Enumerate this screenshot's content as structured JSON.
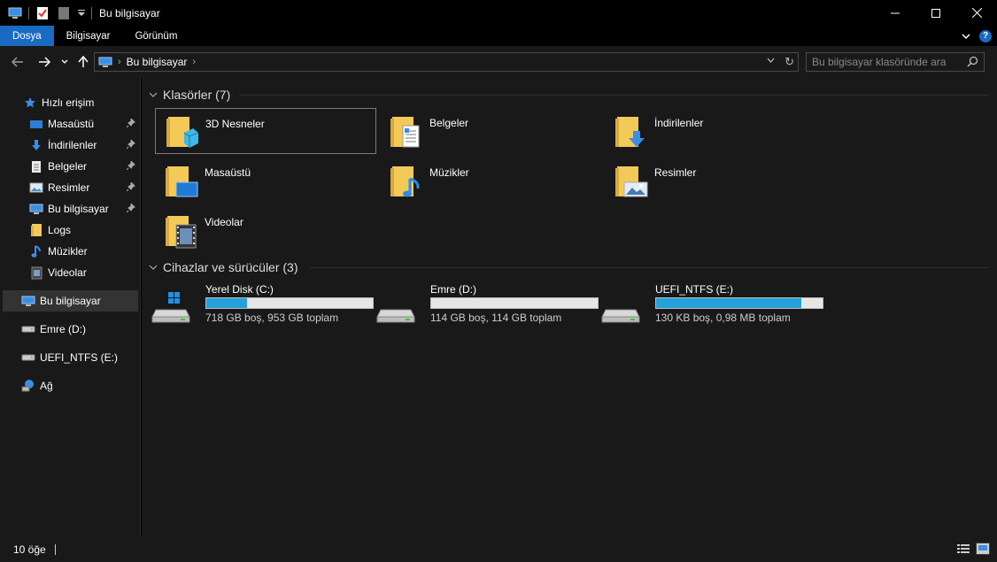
{
  "window": {
    "title": "Bu bilgisayar",
    "minimize_label": "—",
    "maximize_label": "☐",
    "close_label": "✕"
  },
  "ribbon": {
    "tabs": [
      {
        "label": "Dosya",
        "active": true
      },
      {
        "label": "Bilgisayar",
        "active": false
      },
      {
        "label": "Görünüm",
        "active": false
      }
    ],
    "help_label": "?"
  },
  "address": {
    "crumbs": [
      "Bu bilgisayar"
    ]
  },
  "search": {
    "placeholder": "Bu bilgisayar klasöründe ara"
  },
  "sidebar": {
    "quick_access_label": "Hızlı erişim",
    "items": [
      {
        "label": "Masaüstü",
        "icon": "desktop-icon",
        "pinned": true
      },
      {
        "label": "İndirilenler",
        "icon": "download-icon",
        "pinned": true
      },
      {
        "label": "Belgeler",
        "icon": "document-icon",
        "pinned": true
      },
      {
        "label": "Resimler",
        "icon": "pictures-icon",
        "pinned": true
      },
      {
        "label": "Bu bilgisayar",
        "icon": "computer-icon",
        "pinned": true
      },
      {
        "label": "Logs",
        "icon": "folder-icon",
        "pinned": false
      },
      {
        "label": "Müzikler",
        "icon": "music-icon",
        "pinned": false
      },
      {
        "label": "Videolar",
        "icon": "video-icon",
        "pinned": false
      }
    ],
    "this_pc_label": "Bu bilgisayar",
    "drive_d_label": "Emre (D:)",
    "drive_e_label": "UEFI_NTFS (E:)",
    "network_label": "Ağ"
  },
  "main": {
    "folders_header": "Klasörler (7)",
    "folders": [
      {
        "label": "3D Nesneler",
        "icon": "3d-objects-folder-icon"
      },
      {
        "label": "Belgeler",
        "icon": "documents-folder-icon"
      },
      {
        "label": "İndirilenler",
        "icon": "downloads-folder-icon"
      },
      {
        "label": "Masaüstü",
        "icon": "desktop-folder-icon"
      },
      {
        "label": "Müzikler",
        "icon": "music-folder-icon"
      },
      {
        "label": "Resimler",
        "icon": "pictures-folder-icon"
      },
      {
        "label": "Videolar",
        "icon": "videos-folder-icon"
      }
    ],
    "devices_header": "Cihazlar ve sürücüler (3)",
    "drives": [
      {
        "name": "Yerel Disk (C:)",
        "info": "718 GB boş, 953 GB toplam",
        "used_fraction": 0.247,
        "system": true
      },
      {
        "name": "Emre (D:)",
        "info": "114 GB boş, 114 GB toplam",
        "used_fraction": 0.0,
        "system": false
      },
      {
        "name": "UEFI_NTFS (E:)",
        "info": "130 KB boş, 0,98 MB toplam",
        "used_fraction": 0.87,
        "system": false
      }
    ]
  },
  "status": {
    "item_count": "10 öğe"
  },
  "colors": {
    "accent": "#1a6ac4",
    "drive_bar": "#26a0da",
    "background": "#191919"
  }
}
